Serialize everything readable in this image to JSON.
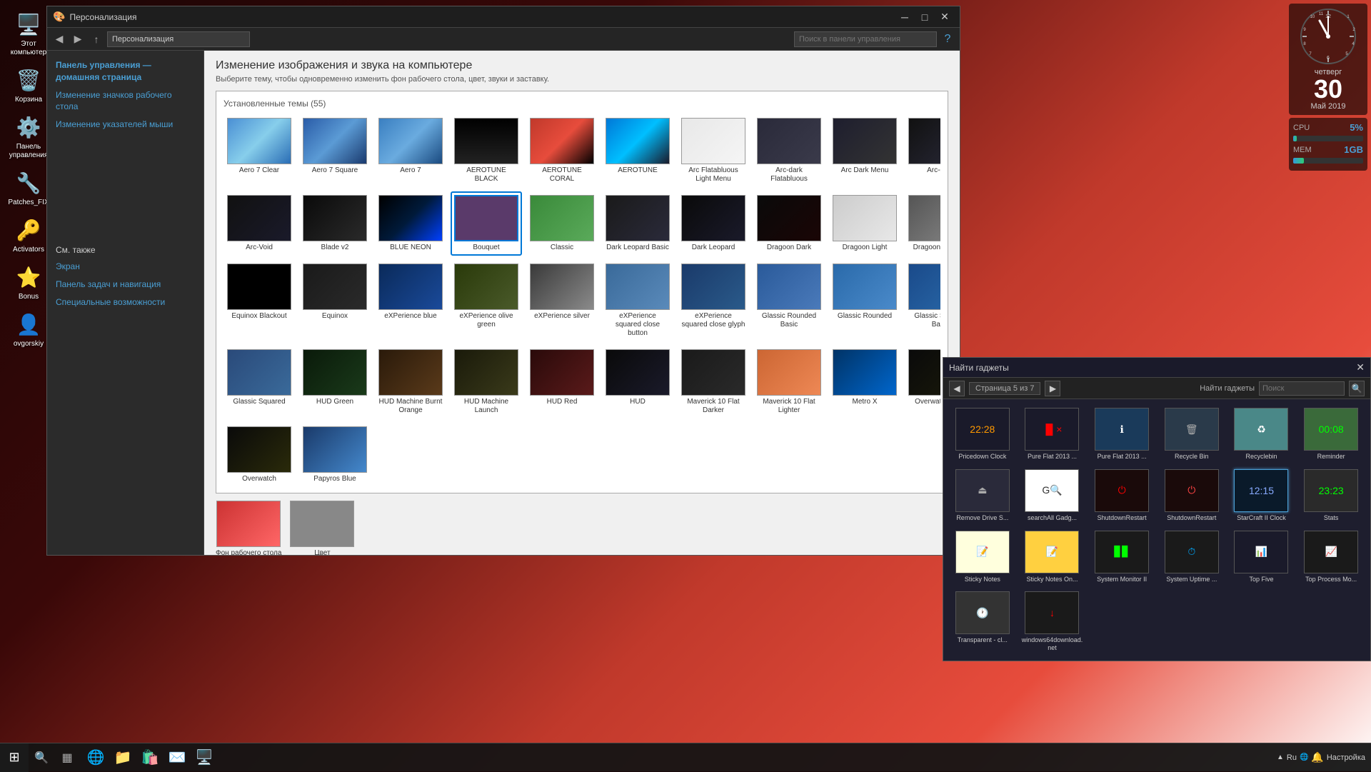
{
  "desktop": {
    "icons": [
      {
        "id": "computer",
        "label": "Этот\nкомпьютер",
        "icon": "🖥️"
      },
      {
        "id": "basket",
        "label": "Корзина",
        "icon": "🗑️"
      },
      {
        "id": "controlpanel",
        "label": "Панель\nуправления",
        "icon": "⚙️"
      },
      {
        "id": "patches",
        "label": "Patches_FIX",
        "icon": "🔧"
      },
      {
        "id": "activators",
        "label": "Activators",
        "icon": "🔑"
      },
      {
        "id": "bonus",
        "label": "Bonus",
        "icon": "⭐"
      },
      {
        "id": "ovgorskiy",
        "label": "ovgorskiy",
        "icon": "👤"
      }
    ],
    "recycle_bin": {
      "label": "Recycle Bin",
      "icon": "🗑️"
    }
  },
  "personalization_window": {
    "title": "Персонализация",
    "addressbar_text": "Персонализация",
    "search_placeholder": "Поиск в панели управления",
    "main_title": "Изменение изображения и звука на компьютере",
    "main_subtitle": "Выберите тему, чтобы одновременно изменить фон рабочего стола, цвет, звуки и заставку.",
    "themes_header": "Установленные темы (55)",
    "sidebar": {
      "nav_title": "Панель управления —\nдомашняя страница",
      "links": [
        "Изменение значков рабочего стола",
        "Изменение указателей мыши"
      ],
      "see_also_title": "См. также",
      "see_also_links": [
        "Экран",
        "Панель задач и навигация",
        "Специальные возможности"
      ]
    },
    "themes": [
      {
        "name": "Aero 7 Clear",
        "bg": "bg-aero7clear"
      },
      {
        "name": "Aero 7 Square",
        "bg": "bg-aero7sq"
      },
      {
        "name": "Aero 7",
        "bg": "bg-aero7"
      },
      {
        "name": "AEROTUNE BLACK",
        "bg": "bg-aerotune-black"
      },
      {
        "name": "AEROTUNE CORAL",
        "bg": "bg-aerotune-coral"
      },
      {
        "name": "AEROTUNE",
        "bg": "bg-aerotune"
      },
      {
        "name": "Arc Flatabluous Light Menu",
        "bg": "bg-arc-flat-light"
      },
      {
        "name": "Arc-dark Flatabluous",
        "bg": "bg-arc-dark-flat"
      },
      {
        "name": "Arc Dark Menu",
        "bg": "bg-arc-dark-menu"
      },
      {
        "name": "Arc-dark",
        "bg": "bg-arc-dark"
      },
      {
        "name": "Arc-Void",
        "bg": "bg-arc-void"
      },
      {
        "name": "Blade v2",
        "bg": "bg-blade"
      },
      {
        "name": "BLUE NEON",
        "bg": "bg-blue-neon"
      },
      {
        "name": "Bouquet",
        "bg": "bg-bouquet",
        "selected": true
      },
      {
        "name": "Classic",
        "bg": "bg-classic"
      },
      {
        "name": "Dark Leopard Basic",
        "bg": "bg-dark-leopard-basic"
      },
      {
        "name": "Dark Leopard",
        "bg": "bg-dark-leopard"
      },
      {
        "name": "Dragoon Dark",
        "bg": "bg-dragoon-dark"
      },
      {
        "name": "Dragoon Light",
        "bg": "bg-dragoon-light"
      },
      {
        "name": "Dragoon Medium",
        "bg": "bg-dragoon-medium"
      },
      {
        "name": "Equinox Blackout",
        "bg": "bg-equinox-blackout"
      },
      {
        "name": "Equinox",
        "bg": "bg-equinox"
      },
      {
        "name": "eXPerience blue",
        "bg": "bg-experience-blue"
      },
      {
        "name": "eXPerience olive green",
        "bg": "bg-experience-olive"
      },
      {
        "name": "eXPerience silver",
        "bg": "bg-experience-silver"
      },
      {
        "name": "eXPerience squared close button",
        "bg": "bg-experience-sq-close-btn"
      },
      {
        "name": "eXPerience squared close glyph",
        "bg": "bg-experience-sq-close-glyph"
      },
      {
        "name": "Glassic Rounded Basic",
        "bg": "bg-glassic-rounded-basic"
      },
      {
        "name": "Glassic Rounded",
        "bg": "bg-glassic-rounded"
      },
      {
        "name": "Glassic Squared Basic",
        "bg": "bg-glassic-sq-basic"
      },
      {
        "name": "Glassic Squared",
        "bg": "bg-glassic-sq"
      },
      {
        "name": "HUD Green",
        "bg": "bg-hud-green"
      },
      {
        "name": "HUD Machine Burnt Orange",
        "bg": "bg-hud-machine-burnt"
      },
      {
        "name": "HUD Machine Launch",
        "bg": "bg-hud-machine-launch"
      },
      {
        "name": "HUD Red",
        "bg": "bg-hud-red"
      },
      {
        "name": "HUD",
        "bg": "bg-hud"
      },
      {
        "name": "Maverick 10 Flat Darker",
        "bg": "bg-maverick-darker"
      },
      {
        "name": "Maverick 10 Flat Lighter",
        "bg": "bg-maverick-lighter"
      },
      {
        "name": "Metro X",
        "bg": "bg-metro-x"
      },
      {
        "name": "Overwatch Dark",
        "bg": "bg-overwatch-dark"
      },
      {
        "name": "Overwatch",
        "bg": "bg-overwatch"
      },
      {
        "name": "Papyros Blue",
        "bg": "bg-papyros-blue"
      }
    ],
    "bottom": {
      "wallpaper_label": "Фон рабочего стола\nStreamofLight",
      "color_label": "Цвет\nДругой"
    }
  },
  "clock_widget": {
    "day": "четверг",
    "date": "30",
    "month_year": "Май 2019"
  },
  "sys_widget": {
    "cpu_label": "CPU",
    "cpu_value": "5%",
    "mem_label": "MEM",
    "mem_value": "1GB"
  },
  "gadgets_panel": {
    "title": "Найти гаджеты",
    "page_info": "Страница 5 из 7",
    "search_placeholder": "Найти гаджеты",
    "gadgets": [
      {
        "name": "Pricedown Clock",
        "color": "#1a1a2a",
        "text_color": "#f90",
        "text": "22:28"
      },
      {
        "name": "Pure Flat 2013 ...",
        "color": "#1a1a2a",
        "text_color": "#f00",
        "text": "▐▌×"
      },
      {
        "name": "Pure Flat 2013 ...",
        "color": "#1a3a5a",
        "text_color": "#fff",
        "text": "ℹ"
      },
      {
        "name": "Recycle Bin",
        "color": "#2a3a4a",
        "text_color": "#aaa",
        "text": "🗑"
      },
      {
        "name": "Recyclebin",
        "color": "#4a8888",
        "text_color": "#fff",
        "text": "♻"
      },
      {
        "name": "Reminder",
        "color": "#3a6a3a",
        "text_color": "#0f0",
        "text": "00:08"
      },
      {
        "name": "Remove Drive S...",
        "color": "#2a2a3a",
        "text_color": "#aaa",
        "text": "⏏"
      },
      {
        "name": "searchAll Gadg...",
        "color": "#fff",
        "text_color": "#333",
        "text": "G🔍"
      },
      {
        "name": "ShutdownRestart",
        "color": "#1a0a0a",
        "text_color": "#f00",
        "text": "⏻"
      },
      {
        "name": "ShutdownRestart",
        "color": "#1a0a0a",
        "text_color": "#f44",
        "text": "⏻"
      },
      {
        "name": "StarCraft II Clock",
        "selected": true,
        "color": "#0a1a2a",
        "text_color": "#8af",
        "text": "12:15"
      },
      {
        "name": "Stats",
        "color": "#2a2a2a",
        "text_color": "#0f0",
        "text": "23:23"
      },
      {
        "name": "Sticky Notes",
        "color": "#ffd",
        "text_color": "#333",
        "text": "📝"
      },
      {
        "name": "Sticky Notes On...",
        "color": "#ffd040",
        "text_color": "#333",
        "text": "📝"
      },
      {
        "name": "System Monitor II",
        "color": "#1a1a1a",
        "text_color": "#0f0",
        "text": "▊▊"
      },
      {
        "name": "System Uptime ...",
        "color": "#1a1a1a",
        "text_color": "#0af",
        "text": "⏱"
      },
      {
        "name": "Top Five",
        "color": "#1a1a2a",
        "text_color": "#aaa",
        "text": "📊"
      },
      {
        "name": "Top Process Mo...",
        "color": "#1a1a1a",
        "text_color": "#aaa",
        "text": "📈"
      },
      {
        "name": "Transparent - cl...",
        "color": "#333",
        "text_color": "#fff",
        "text": "🕐"
      },
      {
        "name": "windows64download.net",
        "color": "#1a1a1a",
        "text_color": "#f00",
        "text": "↓"
      }
    ]
  },
  "taskbar": {
    "start_icon": "⊞",
    "pinned_icons": [
      "🌐",
      "📁",
      "🛍️",
      "✉️",
      "🖥️"
    ],
    "time": "▲ Ru",
    "language": "Ru"
  }
}
